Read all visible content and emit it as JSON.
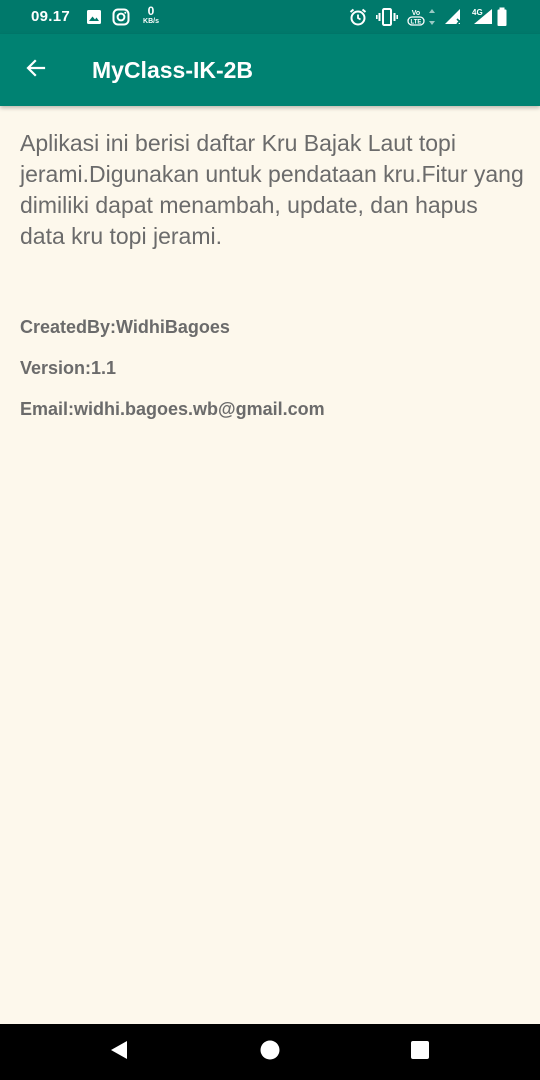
{
  "status_bar": {
    "time": "09.17",
    "net_speed_value": "0",
    "net_speed_unit": "KB/s",
    "network_type": "4G",
    "icons": [
      "image-icon",
      "instagram-icon",
      "alarm-icon",
      "vibrate-icon",
      "volte-icon",
      "data-arrows-icon",
      "signal-icon",
      "signal-4g-icon",
      "battery-icon"
    ]
  },
  "app_bar": {
    "back_icon": "arrow-back-icon",
    "title": "MyClass-IK-2B",
    "color": "#008272"
  },
  "content": {
    "description": "Aplikasi ini berisi daftar Kru Bajak Laut topi jerami.Digunakan untuk pendataan kru.Fitur yang dimiliki dapat menambah, update, dan hapus data kru topi jerami.",
    "created_by": "CreatedBy:WidhiBagoes",
    "version": "Version:1.1",
    "email": "Email:widhi.bagoes.wb@gmail.com"
  },
  "nav_bar": {
    "icons": [
      "back-triangle-icon",
      "home-circle-icon",
      "recents-square-icon"
    ]
  }
}
